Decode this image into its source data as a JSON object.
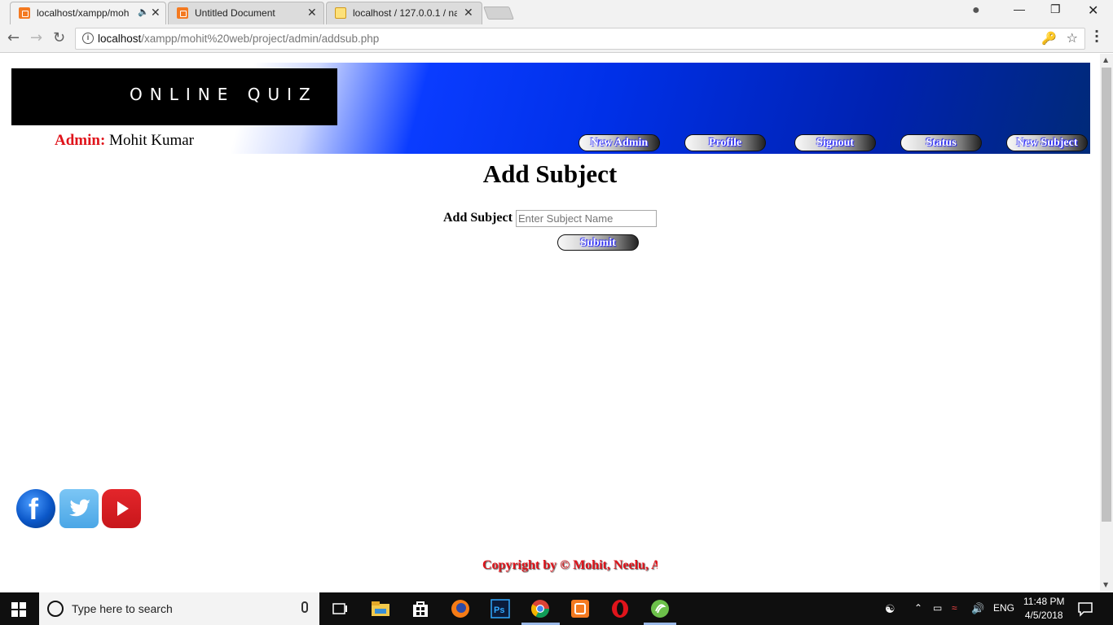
{
  "browser": {
    "tabs": [
      {
        "title": "localhost/xampp/moh",
        "active": true,
        "favicon": "xampp-icon",
        "audio": true
      },
      {
        "title": "Untitled Document",
        "active": false,
        "favicon": "xampp-icon"
      },
      {
        "title": "localhost / 127.0.0.1 / na",
        "active": false,
        "favicon": "phpmyadmin-icon"
      }
    ],
    "url_host": "localhost",
    "url_path": "/xampp/mohit%20web/project/admin/addsub.php"
  },
  "page": {
    "logo_text": "Online Quiz",
    "admin_label": "Admin:",
    "admin_name": "Mohit Kumar",
    "nav": [
      "New Admin",
      "Profile",
      "Signout",
      "Status",
      "New Subject"
    ],
    "title": "Add Subject",
    "form": {
      "label": "Add Subject",
      "placeholder": "Enter Subject Name",
      "submit": "Submit"
    },
    "social": [
      "facebook-icon",
      "twitter-icon",
      "youtube-icon"
    ],
    "copyright": "Copyright by © Mohit, Neelu, A"
  },
  "taskbar": {
    "search_placeholder": "Type here to search",
    "language": "ENG",
    "time": "11:48 PM",
    "date": "4/5/2018"
  },
  "colors": {
    "accent_red": "#e0141b",
    "header_blue": "#0030e8"
  }
}
